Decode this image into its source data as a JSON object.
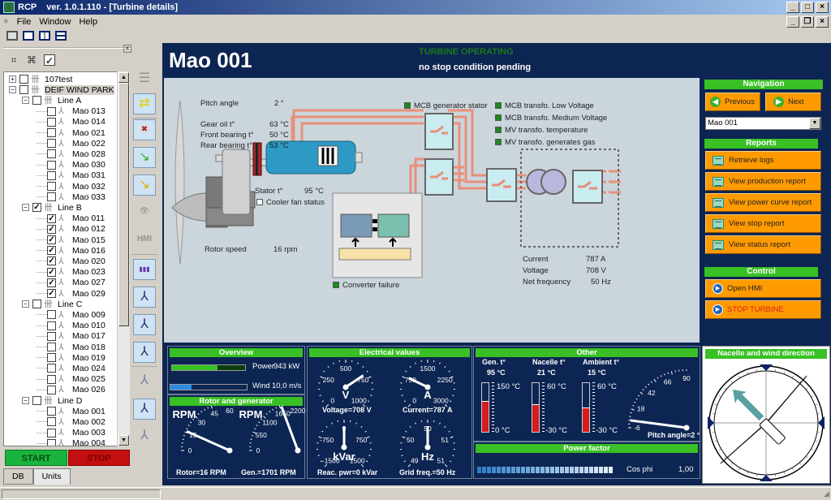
{
  "window": {
    "app_name": "RCP",
    "title": "RCP    ver. 1.0.1.110 - [Turbine details]",
    "menu": [
      "File",
      "Window",
      "Help"
    ]
  },
  "tree": {
    "nodes": [
      {
        "label": "107test",
        "level": 0,
        "expander": "+",
        "checked": false,
        "type": "park"
      },
      {
        "label": "DEIF WIND PARK",
        "level": 0,
        "expander": "-",
        "checked": false,
        "type": "park",
        "selected": true
      },
      {
        "label": "Line A",
        "level": 1,
        "expander": "-",
        "checked": false,
        "type": "line"
      },
      {
        "label": "Mao 013",
        "level": 2,
        "checked": false,
        "type": "turbine"
      },
      {
        "label": "Mao 014",
        "level": 2,
        "checked": false,
        "type": "turbine"
      },
      {
        "label": "Mao 021",
        "level": 2,
        "checked": false,
        "type": "turbine"
      },
      {
        "label": "Mao 022",
        "level": 2,
        "checked": false,
        "type": "turbine"
      },
      {
        "label": "Mao 028",
        "level": 2,
        "checked": false,
        "type": "turbine"
      },
      {
        "label": "Mao 030",
        "level": 2,
        "checked": false,
        "type": "turbine"
      },
      {
        "label": "Mao 031",
        "level": 2,
        "checked": false,
        "type": "turbine"
      },
      {
        "label": "Mao 032",
        "level": 2,
        "checked": false,
        "type": "turbine"
      },
      {
        "label": "Mao 033",
        "level": 2,
        "checked": false,
        "type": "turbine"
      },
      {
        "label": "Line B",
        "level": 1,
        "expander": "-",
        "checked": true,
        "type": "line"
      },
      {
        "label": "Mao 011",
        "level": 2,
        "checked": true,
        "type": "turbine"
      },
      {
        "label": "Mao 012",
        "level": 2,
        "checked": true,
        "type": "turbine"
      },
      {
        "label": "Mao 015",
        "level": 2,
        "checked": true,
        "type": "turbine"
      },
      {
        "label": "Mao 016",
        "level": 2,
        "checked": true,
        "type": "turbine"
      },
      {
        "label": "Mao 020",
        "level": 2,
        "checked": true,
        "type": "turbine"
      },
      {
        "label": "Mao 023",
        "level": 2,
        "checked": true,
        "type": "turbine"
      },
      {
        "label": "Mao 027",
        "level": 2,
        "checked": true,
        "type": "turbine"
      },
      {
        "label": "Mao 029",
        "level": 2,
        "checked": true,
        "type": "turbine"
      },
      {
        "label": "Line C",
        "level": 1,
        "expander": "-",
        "checked": false,
        "type": "line"
      },
      {
        "label": "Mao 009",
        "level": 2,
        "checked": false,
        "type": "turbine"
      },
      {
        "label": "Mao 010",
        "level": 2,
        "checked": false,
        "type": "turbine"
      },
      {
        "label": "Mao 017",
        "level": 2,
        "checked": false,
        "type": "turbine"
      },
      {
        "label": "Mao 018",
        "level": 2,
        "checked": false,
        "type": "turbine"
      },
      {
        "label": "Mao 019",
        "level": 2,
        "checked": false,
        "type": "turbine"
      },
      {
        "label": "Mao 024",
        "level": 2,
        "checked": false,
        "type": "turbine"
      },
      {
        "label": "Mao 025",
        "level": 2,
        "checked": false,
        "type": "turbine"
      },
      {
        "label": "Mao 026",
        "level": 2,
        "checked": false,
        "type": "turbine"
      },
      {
        "label": "Line D",
        "level": 1,
        "expander": "-",
        "checked": false,
        "type": "line"
      },
      {
        "label": "Mao 001",
        "level": 2,
        "checked": false,
        "type": "turbine"
      },
      {
        "label": "Mao 002",
        "level": 2,
        "checked": false,
        "type": "turbine"
      },
      {
        "label": "Mao 003",
        "level": 2,
        "checked": false,
        "type": "turbine"
      },
      {
        "label": "Mao 004",
        "level": 2,
        "checked": false,
        "type": "turbine"
      }
    ]
  },
  "left_buttons": {
    "start": "START",
    "stop": "STOP"
  },
  "left_tabs": [
    "DB",
    "Units"
  ],
  "vertical_toolbar": {
    "icons": [
      "layout-icon",
      "swap-icon",
      "remove-user-icon",
      "import-green-icon",
      "import-yellow-icon",
      "view-icon",
      "hmi-icon",
      "chart-icon",
      "turbine-status-icon",
      "turbine-add-icon",
      "turbine-edit-icon",
      "turbine-icon",
      "turbine-add-green-icon",
      "turbine-remove-icon"
    ],
    "hmi_label": "HMI"
  },
  "header": {
    "unit_name": "Mao 001",
    "operating_status": "TURBINE OPERATING",
    "stop_condition": "no stop condition pending",
    "status_color": "#1a7a1a"
  },
  "diagram": {
    "pitch_angle": {
      "label": "Pitch angle",
      "value": "2 °"
    },
    "gear_oil": {
      "label": "Gear oil t°",
      "value": "63 °C"
    },
    "front_bearing": {
      "label": "Front bearing t°",
      "value": "50 °C"
    },
    "rear_bearing": {
      "label": "Rear bearing t°",
      "value": "53 °C"
    },
    "stator": {
      "label": "Stator t°",
      "value": "95 °C"
    },
    "cooler_fan": {
      "label": "Cooler fan status",
      "on": false
    },
    "rotor_speed": {
      "label": "Rotor speed",
      "value": "16 rpm"
    },
    "mcb_gen_stator": {
      "label": "MCB generator stator",
      "on": true
    },
    "indicators": [
      {
        "label": "MCB transfo. Low Voltage",
        "on": true
      },
      {
        "label": "MCB transfo. Medium Voltage",
        "on": true
      },
      {
        "label": "MV transfo. temperature",
        "on": true
      },
      {
        "label": "MV transfo. generates gas",
        "on": true
      }
    ],
    "converter_failure": {
      "label": "Converter failure",
      "on": true
    },
    "current": {
      "label": "Current",
      "value": "787 A"
    },
    "voltage": {
      "label": "Voltage",
      "value": "708 V"
    },
    "net_frequency": {
      "label": "Net frequency",
      "value": "50 Hz"
    }
  },
  "navigation": {
    "title": "Navigation",
    "previous": "Previous",
    "next": "Next",
    "selected_unit": "Mao 001"
  },
  "reports": {
    "title": "Reports",
    "items": [
      "Retrieve logs",
      "View production report",
      "View power curve report",
      "View stop report",
      "View status report"
    ]
  },
  "control": {
    "title": "Control",
    "open_hmi": "Open HMI",
    "stop_turbine": "STOP TURBINE"
  },
  "overview": {
    "title": "Overview",
    "power_label": "Power",
    "power_value": "943 kW",
    "power_fraction": 0.62,
    "wind_label": "Wind",
    "wind_value": "10,0 m/s",
    "wind_fraction": 0.28
  },
  "rotor_generator": {
    "title": "Rotor and generator",
    "rotor": {
      "unit": "RPM",
      "ticks": [
        "0",
        "15",
        "30",
        "45",
        "60"
      ],
      "min": 0,
      "max": 60,
      "value": 16,
      "caption": "Rotor=16 RPM"
    },
    "generator": {
      "unit": "RPM",
      "ticks": [
        "0",
        "550",
        "1100",
        "1650",
        "2200"
      ],
      "min": 0,
      "max": 2200,
      "value": 1701,
      "caption": "Gen.=1701 RPM"
    }
  },
  "electrical": {
    "title": "Electrical values",
    "voltage": {
      "unit": "V",
      "ticks": [
        "0",
        "250",
        "500",
        "750",
        "1000"
      ],
      "min": 0,
      "max": 1000,
      "value": 708,
      "caption": "Voltage=708 V"
    },
    "current": {
      "unit": "A",
      "ticks": [
        "0",
        "750",
        "1500",
        "2250",
        "3000"
      ],
      "min": 0,
      "max": 3000,
      "value": 787,
      "caption": "Current=787 A"
    },
    "reactive": {
      "unit": "kVar",
      "ticks": [
        "-1500",
        "-750",
        "0",
        "750",
        "1500"
      ],
      "min": -1500,
      "max": 1500,
      "value": 0,
      "caption": "Reac. pwr=0 kVar"
    },
    "frequency": {
      "unit": "Hz",
      "ticks": [
        "49",
        "50",
        "50",
        "51",
        "51"
      ],
      "min": 49,
      "max": 51,
      "value": 50,
      "caption": "Grid freq.=50 Hz"
    }
  },
  "other": {
    "title": "Other",
    "thermometers": [
      {
        "label": "Gen. t°",
        "value": "95 °C",
        "max_label": "150 °C",
        "min_label": "0 °C",
        "fraction": 0.63
      },
      {
        "label": "Nacelle t°",
        "value": "21 °C",
        "max_label": "60 °C",
        "min_label": "-30 °C",
        "fraction": 0.57
      },
      {
        "label": "Ambient t°",
        "value": "15 °C",
        "max_label": "60 °C",
        "min_label": "-30 °C",
        "fraction": 0.5
      }
    ],
    "pitch": {
      "ticks": [
        "-6",
        "18",
        "42",
        "66",
        "90"
      ],
      "min": -6,
      "max": 90,
      "value": 2,
      "caption": "Pitch angle=2 °"
    }
  },
  "power_factor": {
    "title": "Power factor",
    "label": "Cos phi",
    "value": "1,00",
    "fraction": 1.0
  },
  "nacelle_wind": {
    "title": "Nacelle and wind direction",
    "wind_direction_deg": 315,
    "nacelle_direction_deg": 135
  }
}
